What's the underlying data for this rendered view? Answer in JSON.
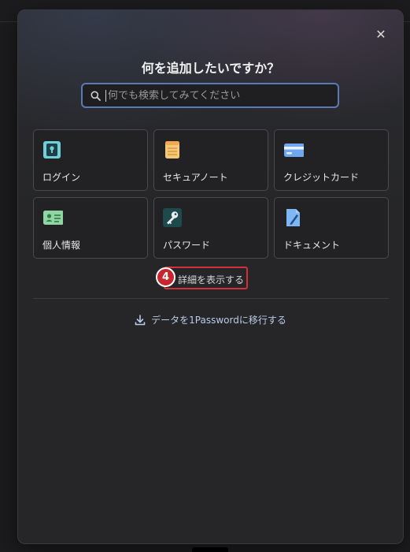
{
  "dialog": {
    "title": "何を追加したいですか？",
    "close_glyph": "✕"
  },
  "search": {
    "placeholder": "何でも検索してみてください",
    "value": ""
  },
  "items": [
    {
      "label": "ログイン",
      "icon": "login-keyhole-icon"
    },
    {
      "label": "セキュアノート",
      "icon": "secure-note-icon"
    },
    {
      "label": "クレジットカード",
      "icon": "credit-card-icon"
    },
    {
      "label": "個人情報",
      "icon": "identity-card-icon"
    },
    {
      "label": "パスワード",
      "icon": "password-key-icon"
    },
    {
      "label": "ドキュメント",
      "icon": "document-icon"
    }
  ],
  "more": {
    "step_number": "4",
    "label": "詳細を表示する"
  },
  "migrate": {
    "label": "データを1Passwordに移行する"
  },
  "colors": {
    "accent_blue": "#5a7ab6",
    "highlight_red": "#d3303a"
  }
}
